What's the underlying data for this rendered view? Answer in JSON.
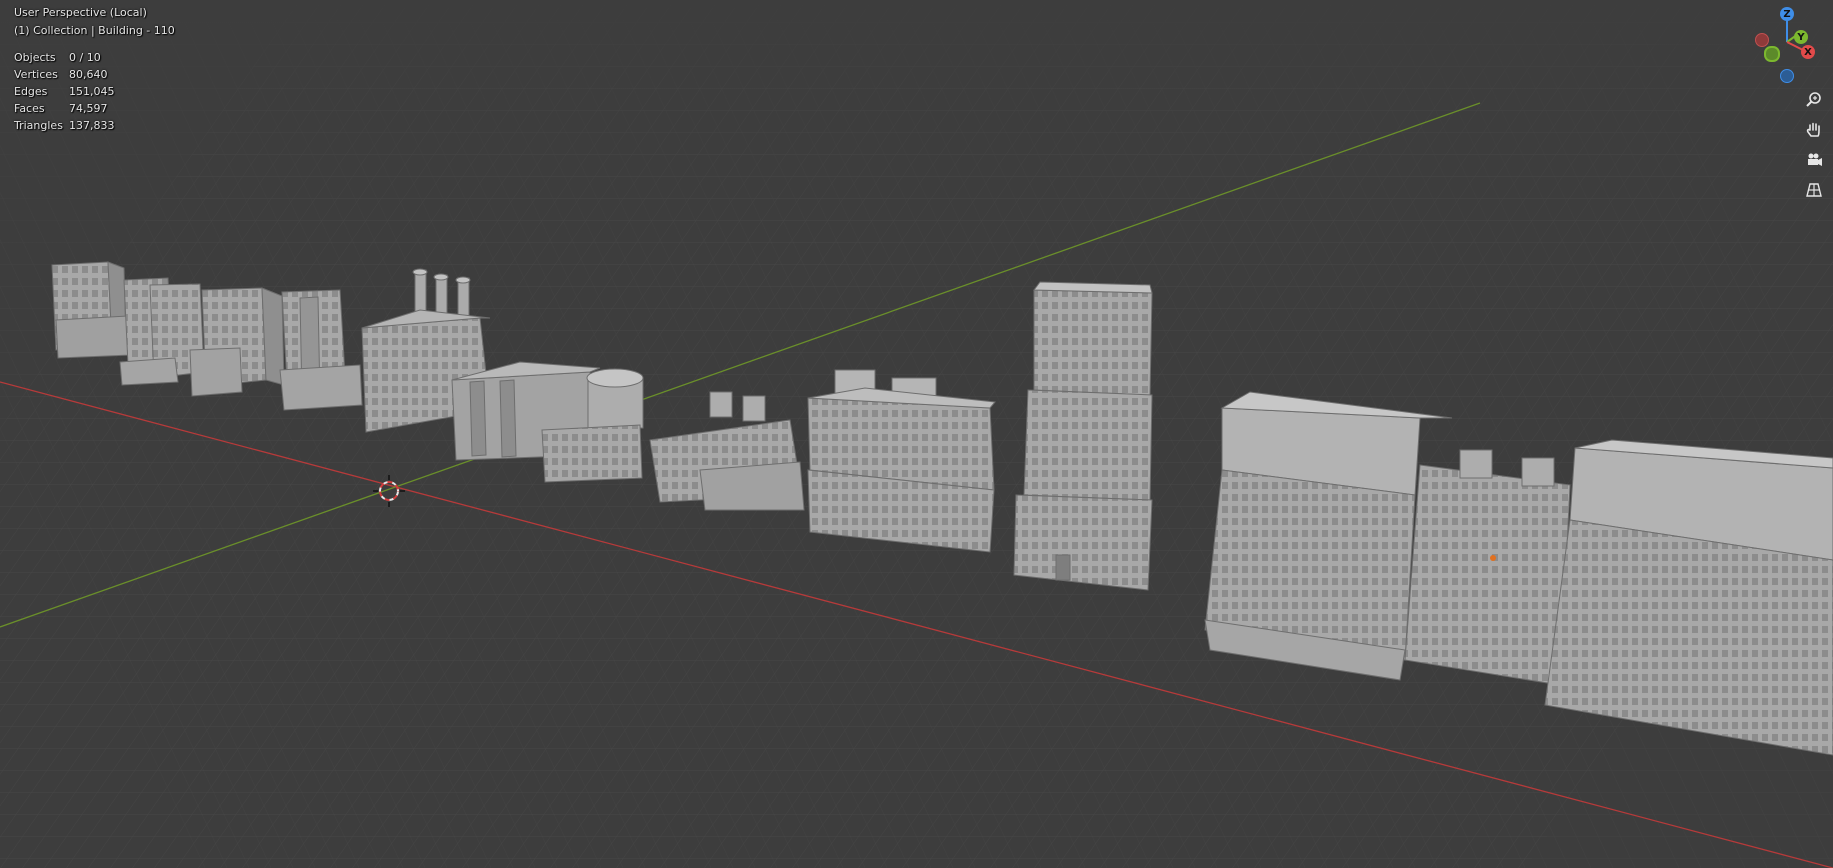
{
  "viewport": {
    "perspective": "User Perspective (Local)",
    "collection": "(1) Collection | Building - 110"
  },
  "stats": [
    {
      "label": "Objects",
      "value": "0 / 10"
    },
    {
      "label": "Vertices",
      "value": "80,640"
    },
    {
      "label": "Edges",
      "value": "151,045"
    },
    {
      "label": "Faces",
      "value": "74,597"
    },
    {
      "label": "Triangles",
      "value": "137,833"
    }
  ],
  "gizmo": {
    "x": "X",
    "y": "Y",
    "z": "Z"
  },
  "navigation": {
    "buttons": [
      "zoom-icon",
      "pan-hand-icon",
      "camera-icon",
      "perspective-grid-icon"
    ]
  },
  "colors": {
    "background": "#3d3d3d",
    "grid_line": "#4a4a4a",
    "x_axis": "#b63a3a",
    "y_axis": "#6a8f2a",
    "model": "#a9a9a9",
    "gizmo_x": "#e24a4a",
    "gizmo_y": "#7cb82f",
    "gizmo_z": "#3f8ee8"
  }
}
